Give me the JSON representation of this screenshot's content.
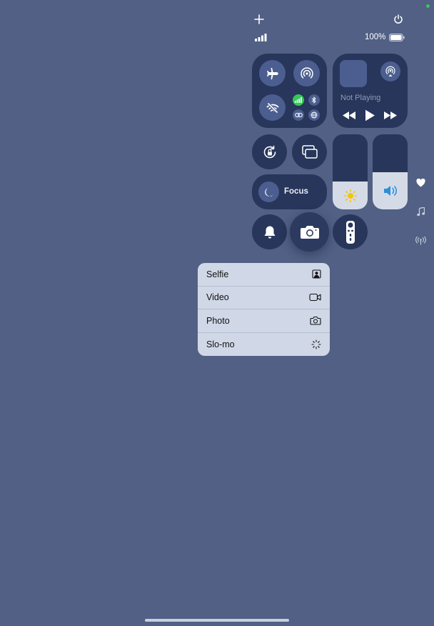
{
  "status": {
    "battery_percent": "100%",
    "battery_level": 1.0
  },
  "media": {
    "now_playing": "Not Playing"
  },
  "focus": {
    "label": "Focus"
  },
  "sliders": {
    "brightness_level": 0.37,
    "volume_level": 0.5
  },
  "camera_menu": {
    "items": [
      {
        "label": "Selfie",
        "icon": "selfie-icon"
      },
      {
        "label": "Video",
        "icon": "video-camera-icon"
      },
      {
        "label": "Photo",
        "icon": "camera-icon"
      },
      {
        "label": "Slo-mo",
        "icon": "slo-mo-icon"
      }
    ]
  },
  "colors": {
    "background": "#516084",
    "tile": "#27365a",
    "active_blue": "#4b5e8f",
    "cellular_green": "#34c759",
    "sun_yellow": "#f5c400",
    "volume_blue": "#2f8fd8"
  }
}
